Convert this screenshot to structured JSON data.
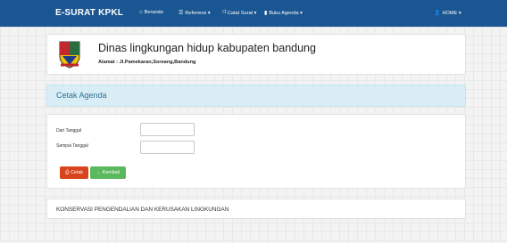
{
  "navbar": {
    "brand": "E-SURAT KPKL",
    "items": [
      {
        "icon": "home-icon",
        "label": "Beranda"
      },
      {
        "icon": "list-icon",
        "label": "Referensi ▾"
      },
      {
        "icon": "shuffle-icon",
        "label": "Catat Surat ▾"
      },
      {
        "icon": "book-icon",
        "label": "Buku Agenda ▾"
      }
    ],
    "user": {
      "icon": "user-icon",
      "label": "HOME ▾"
    },
    "color": "#1a5691"
  },
  "header": {
    "title": "Dinas lingkungan hidup kabupaten bandung",
    "address": "Alamat : Jl.Pamekaran,Soreang,Bandung",
    "logo": "coat-of-arms-logo"
  },
  "section": {
    "heading": "Cetak Agenda"
  },
  "form": {
    "from_label": "Dari Tanggal",
    "to_label": "Sampai Tanggal",
    "from_value": "",
    "to_value": "",
    "print_label": "Cetak",
    "back_label": "← Kembali"
  },
  "footer": {
    "text": "KONSERVASI PENGENDALIAN DAN KERUSAKAN LINGKUNGAN"
  }
}
